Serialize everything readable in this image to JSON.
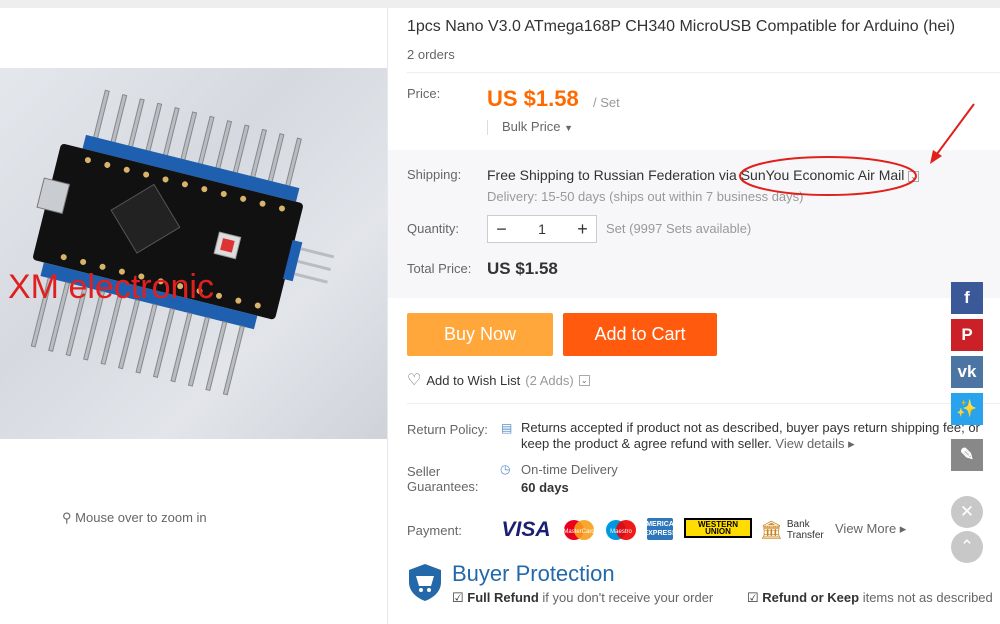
{
  "product": {
    "title": "1pcs Nano V3.0 ATmega168P CH340 MicroUSB Compatible for Arduino (hei)",
    "orders": "2 orders",
    "image_watermark": "XM electronic",
    "zoom_hint": "Mouse over to zoom in"
  },
  "price": {
    "label": "Price:",
    "value": "US $1.58",
    "unit": "/ Set",
    "bulk_label": "Bulk Price"
  },
  "shipping": {
    "label": "Shipping:",
    "free_text": "Free Shipping",
    "to_text": "to Russian Federation via",
    "method": "SunYou Economic Air Mail",
    "delivery": "Delivery: 15-50 days (ships out within 7 business days)"
  },
  "quantity": {
    "label": "Quantity:",
    "value": "1",
    "available": "Set (9997 Sets available)"
  },
  "total": {
    "label": "Total Price:",
    "value": "US $1.58"
  },
  "actions": {
    "buy_now": "Buy Now",
    "add_to_cart": "Add to Cart",
    "wishlist": "Add to Wish List",
    "wishlist_count": "(2 Adds)"
  },
  "policy": {
    "return_label": "Return Policy:",
    "return_text": "Returns accepted if product not as described, buyer pays return shipping fee; or keep the product & agree refund with seller.",
    "view_details": "View details",
    "seller_label": "Seller Guarantees:",
    "guarantee": "On-time Delivery",
    "guarantee_days": "60 days"
  },
  "payment": {
    "label": "Payment:",
    "methods": [
      "VISA",
      "MasterCard",
      "Maestro",
      "AMERICAN EXPRESS",
      "WESTERN UNION",
      "Bank Transfer"
    ],
    "view_more": "View More"
  },
  "buyer_protection": {
    "title": "Buyer Protection",
    "item1_bold": "Full Refund",
    "item1_rest": "if you don't receive your order",
    "item2_bold": "Refund or Keep",
    "item2_rest": "items not as described"
  },
  "colors": {
    "price": "#ff6a00",
    "buy_now": "#ffa73a",
    "add_to_cart": "#ff5a0e",
    "annotation": "#e0201b",
    "buyer_protection": "#2369aa"
  },
  "social": [
    "facebook-icon",
    "pinterest-icon",
    "vk-icon",
    "twitter-icon",
    "edit-icon"
  ]
}
